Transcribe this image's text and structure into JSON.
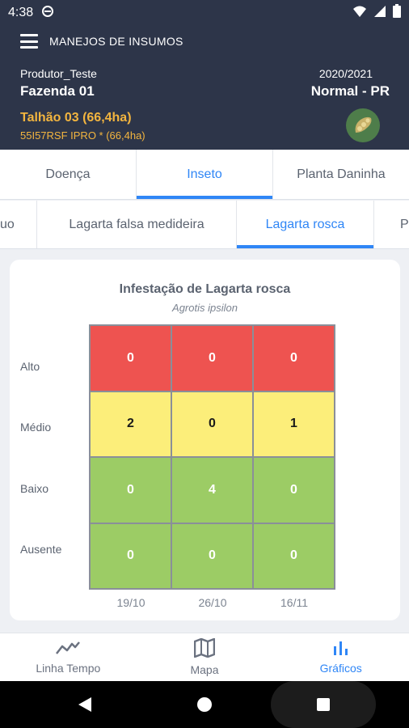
{
  "status_bar": {
    "time": "4:38"
  },
  "header": {
    "menu_icon": "hamburger-icon",
    "app_title": "MANEJOS DE INSUMOS",
    "producer": "Produtor_Teste",
    "farm": "Fazenda 01",
    "season": "2020/2021",
    "season_type": "Normal - PR",
    "plot": "Talhão 03 (66,4ha)",
    "cultivar": "55I57RSF IPRO * (66,4ha)",
    "crop_icon": "soybean-icon",
    "colors": {
      "background": "#2d3549",
      "plot_text": "#f3b53f"
    }
  },
  "category_tabs": [
    {
      "label": "Doença",
      "active": false
    },
    {
      "label": "Inseto",
      "active": true
    },
    {
      "label": "Planta Daninha",
      "active": false
    }
  ],
  "pest_tabs": [
    {
      "label": "uo",
      "active": false
    },
    {
      "label": "Lagarta falsa medideira",
      "active": false
    },
    {
      "label": "Lagarta rosca",
      "active": true
    },
    {
      "label": "Pe",
      "active": false
    }
  ],
  "chart_data": {
    "type": "heatmap",
    "title": "Infestação de Lagarta rosca",
    "subtitle": "Agrotis ipsilon",
    "x_categories": [
      "19/10",
      "26/10",
      "16/11"
    ],
    "y_categories": [
      "Alto",
      "Médio",
      "Baixo",
      "Ausente"
    ],
    "values": [
      [
        0,
        0,
        0
      ],
      [
        2,
        0,
        1
      ],
      [
        0,
        4,
        0
      ],
      [
        0,
        0,
        0
      ]
    ],
    "row_colors": [
      "#ee5350",
      "#fcee7a",
      "#9ccc65",
      "#9ccc65"
    ],
    "row_text_colors": [
      "#ffffff",
      "#1a1a1a",
      "#ffffff",
      "#ffffff"
    ],
    "grid_line_color": "#8a8f99"
  },
  "bottom_nav": [
    {
      "label": "Linha Tempo",
      "icon": "trend-line-icon",
      "active": false
    },
    {
      "label": "Mapa",
      "icon": "map-icon",
      "active": false
    },
    {
      "label": "Gráficos",
      "icon": "bar-chart-icon",
      "active": true
    }
  ],
  "colors": {
    "accent": "#2f86f6"
  }
}
